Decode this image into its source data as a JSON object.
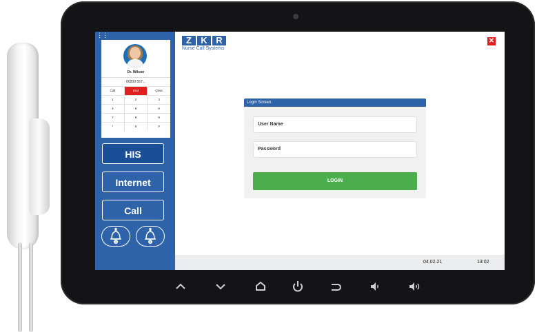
{
  "phone": {
    "contact_name": "Dr. Wilson",
    "number": "00200 557...",
    "keys": [
      [
        "Call",
        "End",
        "Clear"
      ],
      [
        "1",
        "2",
        "3"
      ],
      [
        "4",
        "5",
        "6"
      ],
      [
        "7",
        "8",
        "9"
      ],
      [
        "*",
        "0",
        "#"
      ]
    ]
  },
  "nav": {
    "his": "HIS",
    "internet": "Internet",
    "call": "Call",
    "bell1_number": "1",
    "bell2_number": "2"
  },
  "brand": {
    "logo_letters": [
      "Z",
      "K",
      "R"
    ],
    "subtitle": "Nurse Call Systems"
  },
  "close": {
    "glyph": "✕"
  },
  "login": {
    "header": "Login Screen",
    "username_placeholder": "User Name",
    "password_placeholder": "Password",
    "button": "LOGIN"
  },
  "footer": {
    "date": "04.02.21",
    "time": "13:02"
  },
  "colors": {
    "panel_blue": "#2e63a9",
    "his_blue": "#1a4f98",
    "end_red": "#e02020",
    "login_green": "#4cad4c"
  },
  "softkeys": {
    "up": "chevron-up-icon",
    "down": "chevron-down-icon",
    "home": "home-icon",
    "power": "power-icon",
    "back": "back-icon",
    "vol_down": "volume-down-icon",
    "vol_up": "volume-up-icon"
  }
}
